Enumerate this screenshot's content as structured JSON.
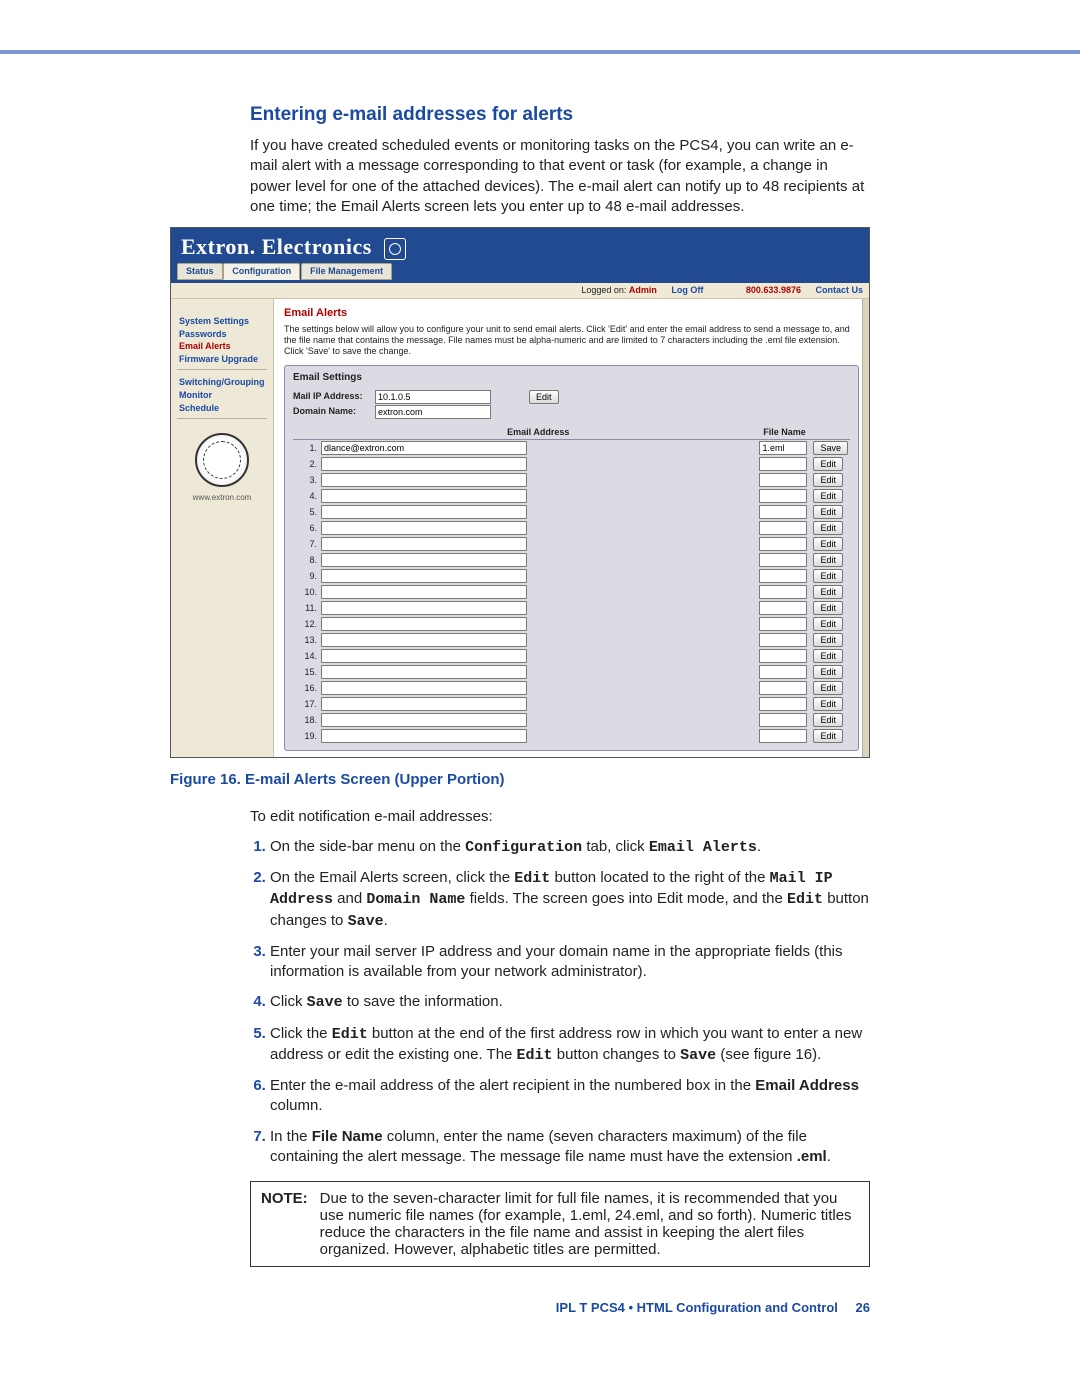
{
  "heading": "Entering e-mail addresses for alerts",
  "intro_para": "If you have created scheduled events or monitoring tasks on the PCS4, you can write an e-mail alert with a message corresponding to that event or task (for example, a change in power level for one of the attached devices). The e-mail alert can notify up to 48 recipients at one time; the Email Alerts screen lets you enter up to 48 e-mail addresses.",
  "app": {
    "brand": "Extron. Electronics",
    "tabs": [
      "Status",
      "Configuration",
      "File Management"
    ],
    "active_tab": 1,
    "phone": "800.633.9876",
    "logged_label": "Logged on:",
    "logged_user": "Admin",
    "logoff": "Log Off",
    "contact": "Contact Us",
    "sidebar": {
      "group1": [
        "System Settings",
        "Passwords",
        "Email Alerts",
        "Firmware Upgrade"
      ],
      "group2": [
        "Switching/Grouping",
        "Monitor",
        "Schedule"
      ],
      "active": "Email Alerts",
      "url": "www.extron.com"
    },
    "main": {
      "title": "Email Alerts",
      "blurb": "The settings below will allow you to configure your unit to send email alerts. Click 'Edit' and enter the email address to send a message to, and the file name that contains the message. File names must be alpha-numeric and are limited to 7 characters including the .eml file extension. Click 'Save' to save the change.",
      "panel_title": "Email Settings",
      "mail_ip_label": "Mail IP Address:",
      "mail_ip": "10.1.0.5",
      "domain_label": "Domain Name:",
      "domain": "extron.com",
      "edit_btn": "Edit",
      "col_email": "Email Address",
      "col_file": "File Name",
      "rows": [
        {
          "n": 1,
          "email": "dlance@extron.com",
          "file": "1.eml",
          "btn": "Save"
        },
        {
          "n": 2,
          "email": "",
          "file": "",
          "btn": "Edit"
        },
        {
          "n": 3,
          "email": "",
          "file": "",
          "btn": "Edit"
        },
        {
          "n": 4,
          "email": "",
          "file": "",
          "btn": "Edit"
        },
        {
          "n": 5,
          "email": "",
          "file": "",
          "btn": "Edit"
        },
        {
          "n": 6,
          "email": "",
          "file": "",
          "btn": "Edit"
        },
        {
          "n": 7,
          "email": "",
          "file": "",
          "btn": "Edit"
        },
        {
          "n": 8,
          "email": "",
          "file": "",
          "btn": "Edit"
        },
        {
          "n": 9,
          "email": "",
          "file": "",
          "btn": "Edit"
        },
        {
          "n": 10,
          "email": "",
          "file": "",
          "btn": "Edit"
        },
        {
          "n": 11,
          "email": "",
          "file": "",
          "btn": "Edit"
        },
        {
          "n": 12,
          "email": "",
          "file": "",
          "btn": "Edit"
        },
        {
          "n": 13,
          "email": "",
          "file": "",
          "btn": "Edit"
        },
        {
          "n": 14,
          "email": "",
          "file": "",
          "btn": "Edit"
        },
        {
          "n": 15,
          "email": "",
          "file": "",
          "btn": "Edit"
        },
        {
          "n": 16,
          "email": "",
          "file": "",
          "btn": "Edit"
        },
        {
          "n": 17,
          "email": "",
          "file": "",
          "btn": "Edit"
        },
        {
          "n": 18,
          "email": "",
          "file": "",
          "btn": "Edit"
        },
        {
          "n": 19,
          "email": "",
          "file": "",
          "btn": "Edit"
        }
      ]
    }
  },
  "fig_label": "Figure 16.",
  "fig_title": "E-mail Alerts Screen (Upper Portion)",
  "after_fig": "To edit notification e-mail addresses:",
  "steps": {
    "s1_a": "On the side-bar menu on the ",
    "s1_conf": "Configuration",
    "s1_b": " tab, click ",
    "s1_alerts": "Email Alerts",
    "s1_c": ".",
    "s2_a": "On the Email Alerts screen, click the ",
    "s2_edit": "Edit",
    "s2_b": " button located to the right of the ",
    "s2_mail": "Mail IP Address",
    "s2_c": " and ",
    "s2_dom": "Domain Name",
    "s2_d": " fields. The screen goes into Edit mode, and the ",
    "s2_e": " button changes to ",
    "s2_save": "Save",
    "s2_f": ".",
    "s3": "Enter your mail server IP address and your domain name in the appropriate fields (this information is available from your network administrator).",
    "s4_a": "Click ",
    "s4_save": "Save",
    "s4_b": " to save the information.",
    "s5_a": "Click the ",
    "s5_edit": "Edit",
    "s5_b": " button at the end of the first address row in which you want to enter a new address or edit the existing one. The ",
    "s5_c": " button changes to ",
    "s5_save": "Save",
    "s5_d": " (see figure 16).",
    "s6_a": "Enter the e-mail address of the alert recipient in the numbered box in the ",
    "s6_col": "Email Address",
    "s6_b": " column.",
    "s7_a": "In the ",
    "s7_col": "File Name",
    "s7_b": " column, enter the name (seven characters maximum) of the file containing the alert message. The message file name must have the extension ",
    "s7_ext": ".eml",
    "s7_c": "."
  },
  "note": {
    "label": "NOTE:",
    "text": "Due to the seven-character limit for full file names, it is recommended that you use numeric file names (for example, 1.eml, 24.eml, and so forth). Numeric titles reduce the characters in the file name and assist in keeping the alert files organized. However, alphabetic titles are permitted."
  },
  "footer": {
    "product": "IPL T PCS4 • HTML Configuration and Control",
    "page": "26"
  }
}
